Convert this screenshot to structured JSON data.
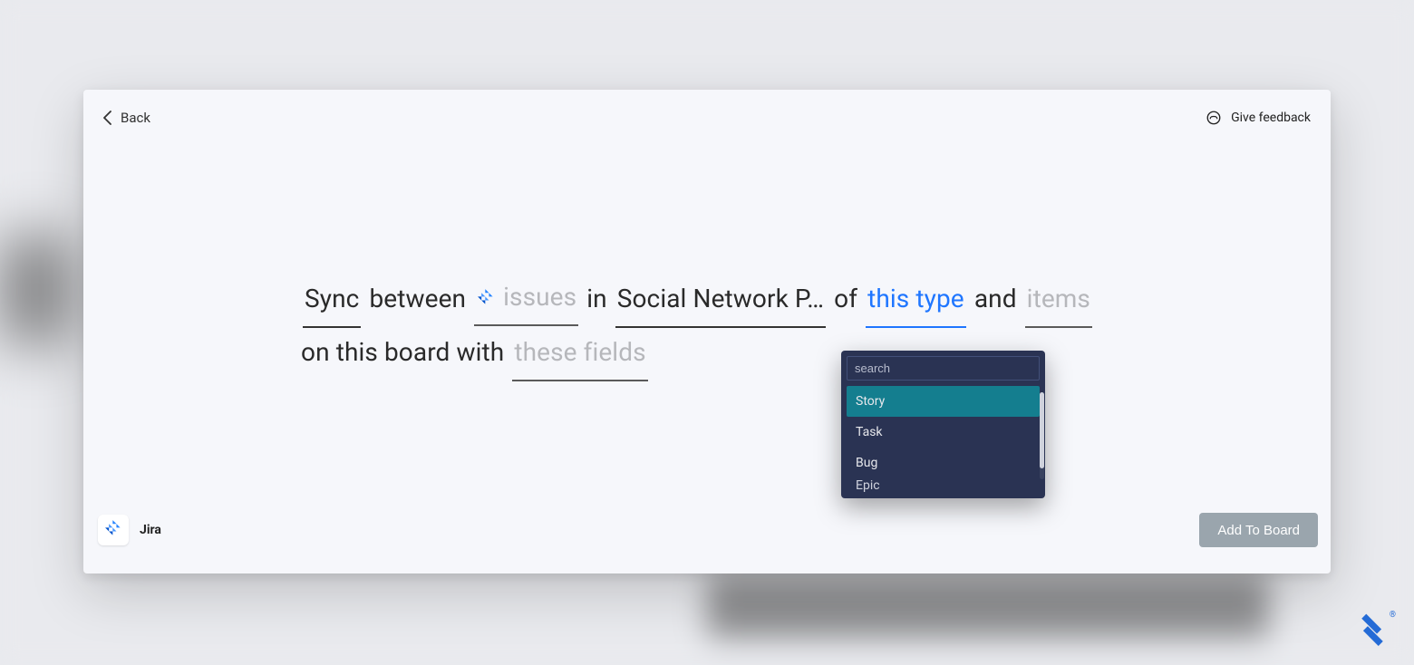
{
  "header": {
    "back_label": "Back",
    "feedback_label": "Give feedback"
  },
  "sentence": {
    "w_sync": "Sync",
    "w_between": "between",
    "source_slot": "issues",
    "w_in": "in",
    "project_slot": "Social Network P…",
    "w_of": "of",
    "type_slot": "this type",
    "w_and": "and",
    "items_slot": "items",
    "w_on": "on",
    "w_this_board_with": "this board with",
    "fields_slot": "these fields"
  },
  "dropdown": {
    "search_placeholder": "search",
    "options": [
      "Story",
      "Task",
      "Bug",
      "Epic"
    ],
    "selected_index": 0
  },
  "footer": {
    "app_name": "Jira",
    "add_button_label": "Add To Board"
  },
  "watermark_registered": "®"
}
